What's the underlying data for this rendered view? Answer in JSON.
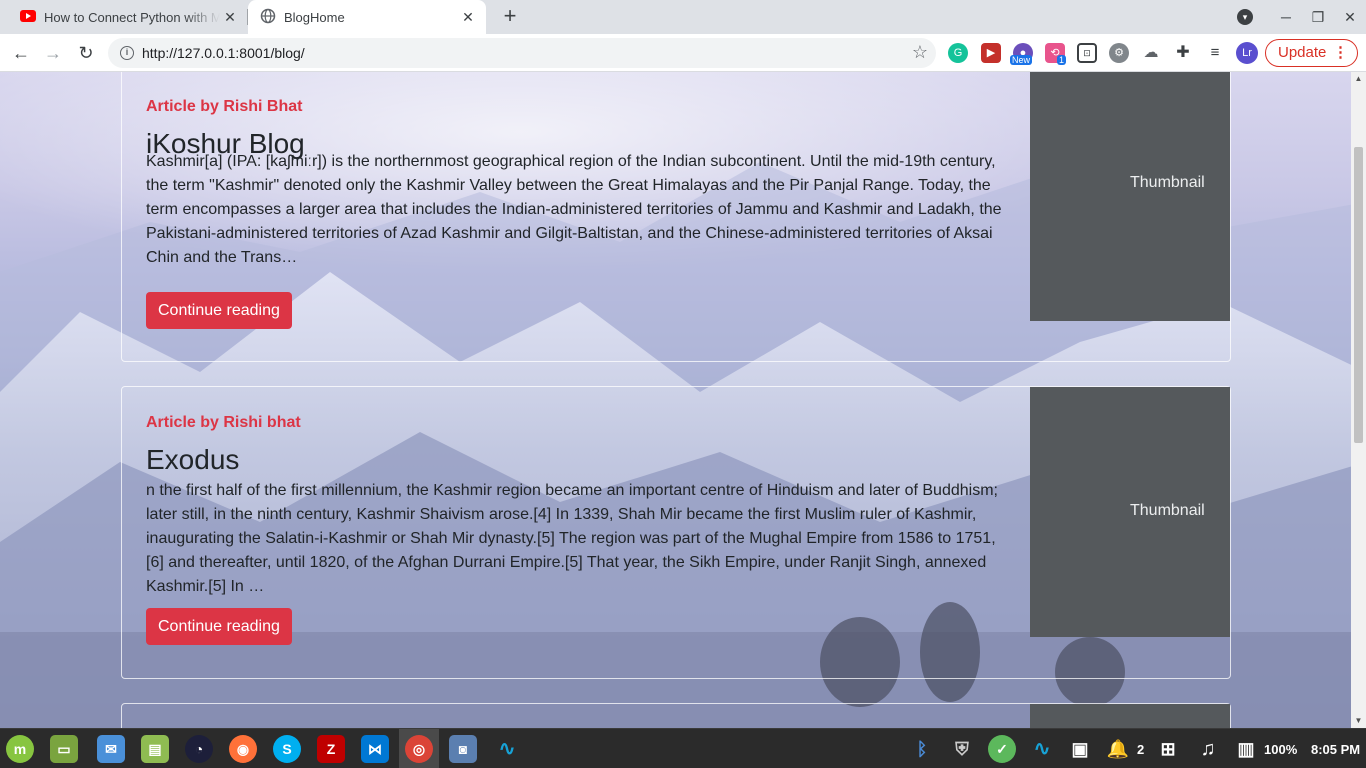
{
  "browser": {
    "tabs": [
      {
        "title": "How to Connect Python with M",
        "favicon": "youtube-icon"
      },
      {
        "title": "BlogHome",
        "favicon": "globe-icon"
      }
    ],
    "url": "http://127.0.0.1:8001/blog/",
    "extension_badges": {
      "new": "New",
      "count": "1"
    },
    "profile_initials": "Lr",
    "update_label": "Update"
  },
  "posts": [
    {
      "author": "Article by Rishi Bhat",
      "title": "iKoshur Blog",
      "excerpt": "Kashmir[a] (IPA: [kaʃmiːr]) is the northernmost geographical region of the Indian subcontinent. Until the mid-19th century, the term \"Kashmir\" denoted only the Kashmir Valley between the Great Himalayas and the Pir Panjal Range. Today, the term encompasses a larger area that includes the Indian-administered territories of Jammu and Kashmir and Ladakh, the Pakistani-administered territories of Azad Kashmir and Gilgit-Baltistan, and the Chinese-administered territories of Aksai Chin and the Trans…",
      "cta": "Continue reading",
      "thumbnail": "Thumbnail"
    },
    {
      "author": "Article by Rishi bhat",
      "title": "Exodus",
      "excerpt": "n the first half of the first millennium, the Kashmir region became an important centre of Hinduism and later of Buddhism; later still, in the ninth century, Kashmir Shaivism arose.[4] In 1339, Shah Mir became the first Muslim ruler of Kashmir, inaugurating the Salatin-i-Kashmir or Shah Mir dynasty.[5] The region was part of the Mughal Empire from 1586 to 1751,[6] and thereafter, until 1820, of the Afghan Durrani Empire.[5] That year, the Sikh Empire, under Ranjit Singh, annexed Kashmir.[5] In …",
      "cta": "Continue reading",
      "thumbnail": "Thumbnail"
    }
  ],
  "taskbar": {
    "notification_count": "2",
    "volume": "100%",
    "clock": "8:05 PM"
  },
  "colors": {
    "accent_red": "#dc3545",
    "thumbnail_bg": "#55595c"
  }
}
